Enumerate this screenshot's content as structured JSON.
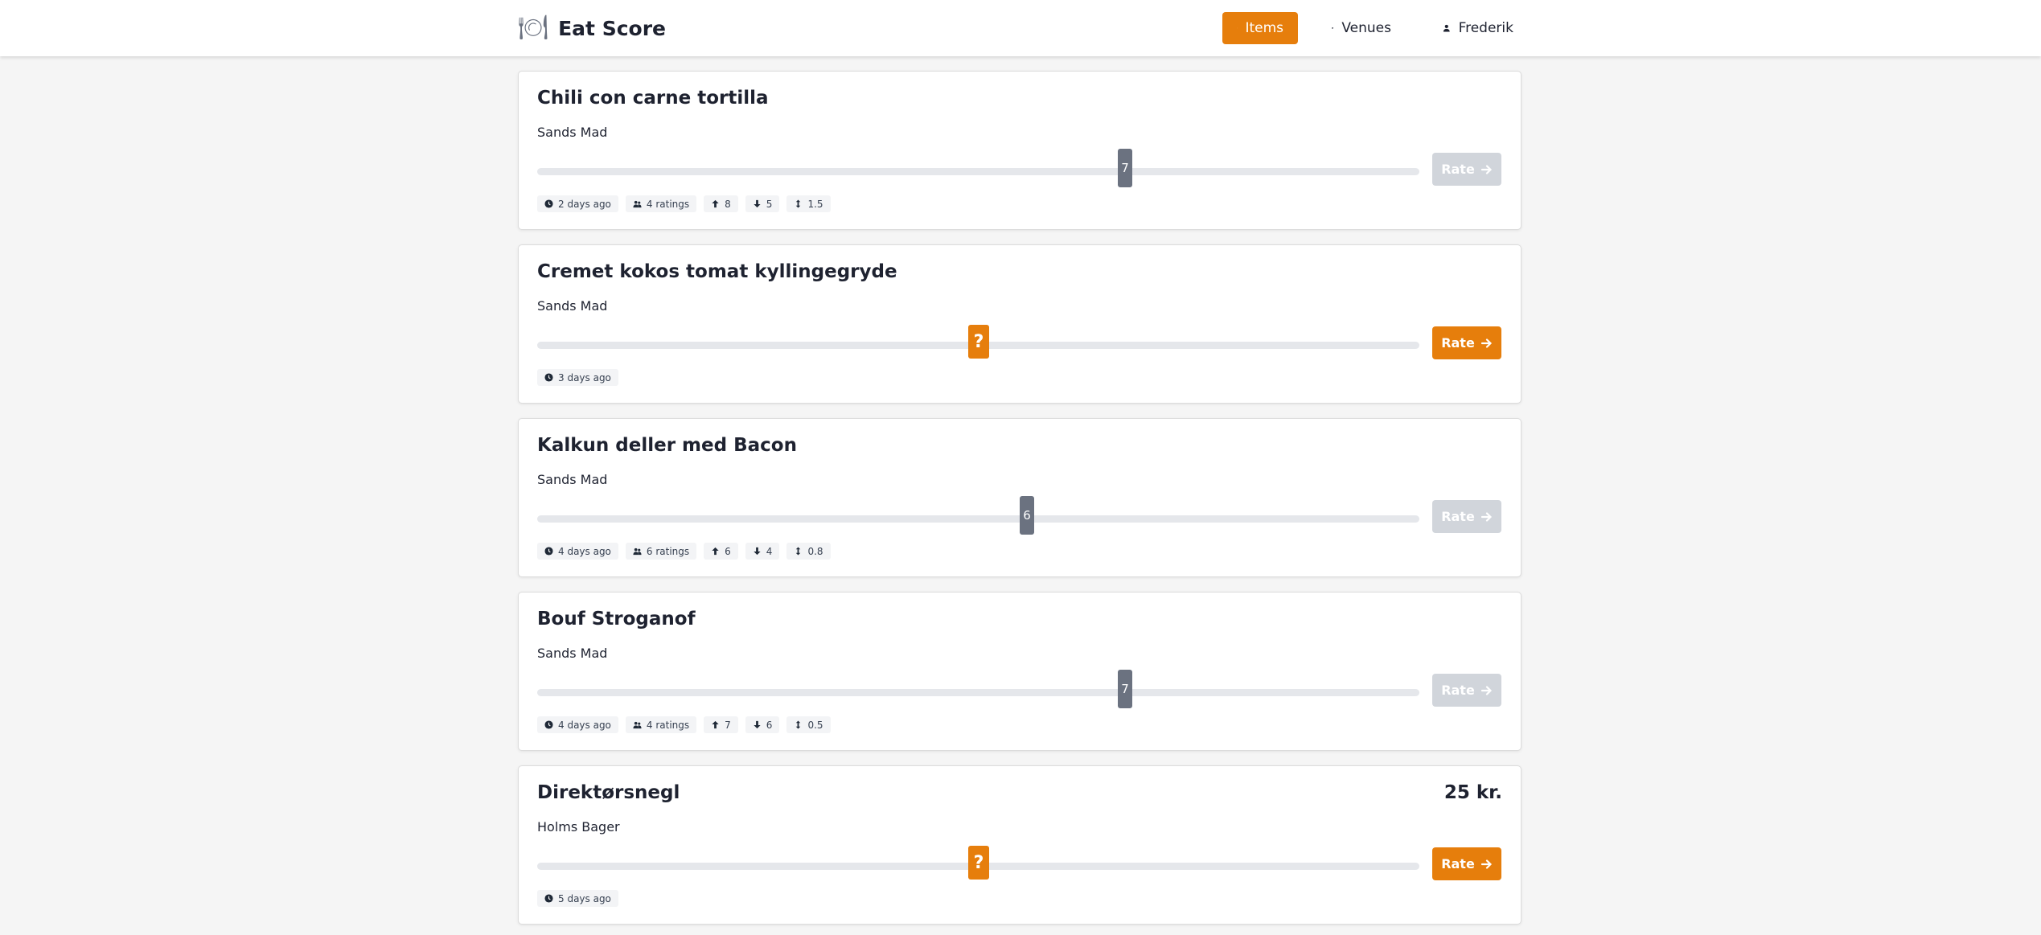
{
  "app": {
    "title": "Eat Score",
    "logo_icon": "plate-icon"
  },
  "nav": {
    "items_label": "Items",
    "venues_label": "Venues",
    "user_label": "Frederik",
    "active": "Items",
    "accent_color": "#e67e0c"
  },
  "rating_scale": {
    "min": 1,
    "max": 10
  },
  "items": [
    {
      "name": "Chili con carne tortilla",
      "venue": "Sands Mad",
      "price": "",
      "rating": 7,
      "rating_label": "7",
      "rated": true,
      "rate_label": "Rate",
      "age": "2 days ago",
      "ratings": "4 ratings",
      "up": "8",
      "down": "5",
      "spread": "1.5"
    },
    {
      "name": "Cremet kokos tomat kyllingegryde",
      "venue": "Sands Mad",
      "price": "",
      "rating": 5.5,
      "rating_label": "?",
      "rated": false,
      "rate_label": "Rate",
      "age": "3 days ago"
    },
    {
      "name": "Kalkun deller med Bacon",
      "venue": "Sands Mad",
      "price": "",
      "rating": 6,
      "rating_label": "6",
      "rated": true,
      "rate_label": "Rate",
      "age": "4 days ago",
      "ratings": "6 ratings",
      "up": "6",
      "down": "4",
      "spread": "0.8"
    },
    {
      "name": "Bouf Stroganof",
      "venue": "Sands Mad",
      "price": "",
      "rating": 7,
      "rating_label": "7",
      "rated": true,
      "rate_label": "Rate",
      "age": "4 days ago",
      "ratings": "4 ratings",
      "up": "7",
      "down": "6",
      "spread": "0.5"
    },
    {
      "name": "Direktørsnegl",
      "venue": "Holms Bager",
      "price": "25 kr.",
      "rating": 5.5,
      "rating_label": "?",
      "rated": false,
      "rate_label": "Rate",
      "age": "5 days ago"
    }
  ]
}
